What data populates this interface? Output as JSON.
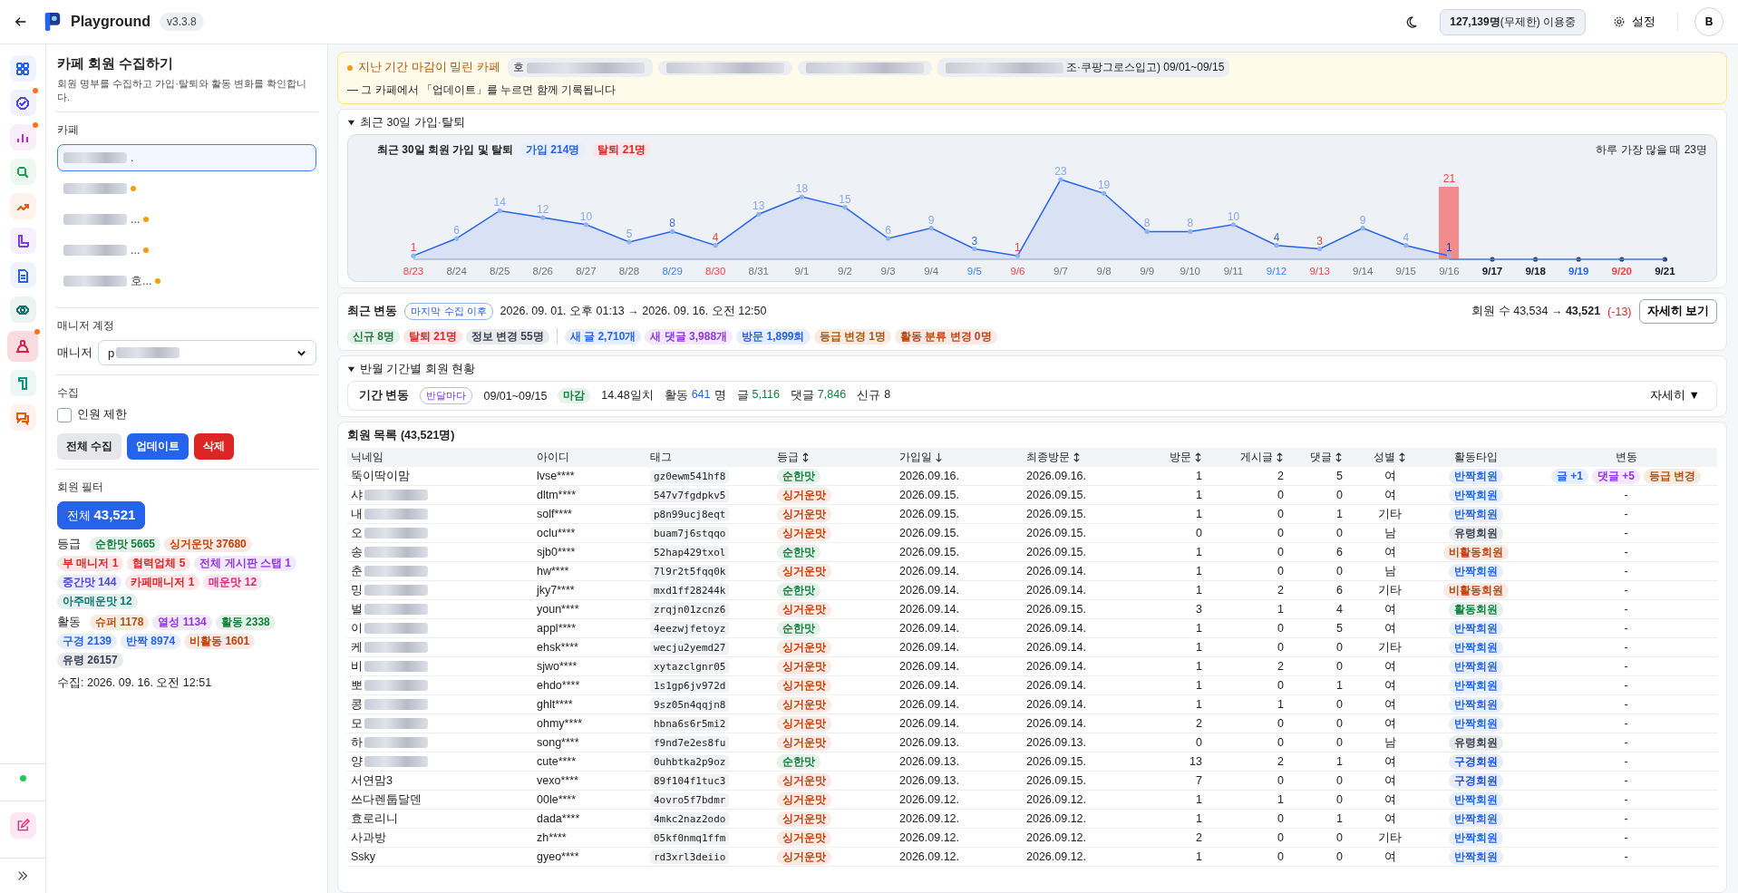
{
  "header": {
    "app_name": "Playground",
    "version": "v3.3.8",
    "usage": "**127,139명**(무제한) 이용중",
    "settings": "설정",
    "avatar": "B"
  },
  "rail": {
    "items": [
      {
        "color": "#2563eb",
        "selected": false,
        "badge": false
      },
      {
        "color": "#4f46e5",
        "selected": false,
        "badge": true
      },
      {
        "color": "#c026d3",
        "selected": false,
        "badge": true
      },
      {
        "color": "#16a34a",
        "selected": false,
        "badge": false
      },
      {
        "color": "#ea580c",
        "selected": false,
        "badge": false
      },
      {
        "color": "#7c3aed",
        "selected": false,
        "badge": false
      },
      {
        "color": "#2563eb",
        "selected": false,
        "badge": false
      },
      {
        "color": "#0f766e",
        "selected": false,
        "badge": false
      },
      {
        "color": "#e11d48",
        "selected": true,
        "badge": true
      },
      {
        "color": "#0d9488",
        "selected": false,
        "badge": false
      },
      {
        "color": "#ea580c",
        "selected": false,
        "badge": false
      }
    ],
    "online": true
  },
  "sidebar": {
    "title": "카페 회원 수집하기",
    "subtitle": "회원 명부를 수집하고 가입·탈퇴와 활동 변화를 확인합니다.",
    "cafe_label": "카페",
    "cafes": [
      {
        "text": ".",
        "blurred": true,
        "selected": true,
        "alert": false
      },
      {
        "blurred": true,
        "selected": false,
        "alert": true
      },
      {
        "text": "...",
        "blurred": true,
        "selected": false,
        "alert": true
      },
      {
        "text": "...",
        "blurred": true,
        "selected": false,
        "alert": true
      },
      {
        "text": "호...",
        "blurred": true,
        "selected": false,
        "alert": true
      }
    ],
    "manager_section": "매니저 계정",
    "manager_label": "매니저",
    "manager_value": {
      "text": "p",
      "blurred": true
    },
    "collect_section": "수집",
    "limit": {
      "label": "인원 제한",
      "checked": false
    },
    "buttons": [
      {
        "label": "전체 수집",
        "kind": "neutral"
      },
      {
        "label": "업데이트",
        "kind": "primary"
      },
      {
        "label": "삭제",
        "kind": "danger"
      }
    ],
    "filter_section": "회원 필터",
    "all_filter": {
      "label": "전체",
      "count": "43,521",
      "selected": true
    },
    "groups": [
      {
        "label": "등급",
        "chips": [
          {
            "text": "순한맛 5665",
            "color": "#15803d"
          },
          {
            "text": "싱거운맛 37680",
            "color": "#c2410c"
          },
          {
            "text": "부 매니저 1",
            "color": "#dc2626"
          },
          {
            "text": "협력업체 5",
            "color": "#dc2626"
          },
          {
            "text": "전체 게시판 스탭 1",
            "color": "#9333ea"
          },
          {
            "text": "중간맛 144",
            "color": "#4f46e5"
          },
          {
            "text": "카페매니저 1",
            "color": "#dc2626"
          },
          {
            "text": "매운맛 12",
            "color": "#db2777"
          },
          {
            "text": "아주매운맛 12",
            "color": "#0f766e"
          }
        ]
      },
      {
        "label": "활동",
        "chips": [
          {
            "text": "슈퍼 1178",
            "color": "#b45309"
          },
          {
            "text": "열성 1134",
            "color": "#9333ea"
          },
          {
            "text": "활동 2338",
            "color": "#15803d"
          },
          {
            "text": "구경 2139",
            "color": "#2563eb"
          },
          {
            "text": "반짝 8974",
            "color": "#2563eb"
          },
          {
            "text": "비활동 1601",
            "color": "#c2410c"
          },
          {
            "text": "유령 26157",
            "color": "#374151"
          }
        ]
      }
    ],
    "collected_at": "수집: 2026. 09. 16. 오전 12:51"
  },
  "banner": {
    "title": "지난 기간 마감이 밀린 카페",
    "cafes": [
      {
        "text": "호",
        "blur_after": true
      },
      {
        "blur_before": true
      },
      {
        "blur_before": true
      },
      {
        "text": "조·쿠팡그로스입고) 09/01~09/15",
        "blur_before": true
      }
    ],
    "note": "— 그 카페에서 「업데이트」를 누르면 함께 기록됩니다"
  },
  "recent": {
    "title": "최근 30일 가입·탈퇴",
    "expanded": true,
    "chart": {
      "title": "최근 30일 회원 가입 및 탈퇴",
      "joins": "214명",
      "leaves": "탈퇴 21명",
      "peak": "하루 가장 많을 때 23명",
      "days": [
        {
          "sat": false,
          "sun": true,
          "future": false
        },
        {
          "sat": false,
          "sun": false,
          "future": false
        },
        {
          "sat": false,
          "sun": false,
          "future": false
        },
        {
          "sat": false,
          "sun": false,
          "future": false
        },
        {
          "sat": false,
          "sun": false,
          "future": false
        },
        {
          "sat": false,
          "sun": false,
          "future": false
        },
        {
          "sat": true,
          "sun": false,
          "future": false
        },
        {
          "sat": false,
          "sun": true,
          "future": false
        },
        {
          "sat": false,
          "sun": false,
          "future": false
        },
        {
          "sat": false,
          "sun": false,
          "future": false
        },
        {
          "sat": false,
          "sun": false,
          "future": false
        },
        {
          "sat": false,
          "sun": false,
          "future": false
        },
        {
          "sat": false,
          "sun": false,
          "future": false
        },
        {
          "sat": true,
          "sun": false,
          "future": false
        },
        {
          "sat": false,
          "sun": true,
          "future": false
        },
        {
          "sat": false,
          "sun": false,
          "future": false
        },
        {
          "sat": false,
          "sun": false,
          "future": false
        },
        {
          "sat": false,
          "sun": false,
          "future": false
        },
        {
          "sat": false,
          "sun": false,
          "future": false
        },
        {
          "sat": false,
          "sun": false,
          "future": false
        },
        {
          "sat": true,
          "sun": false,
          "future": false
        },
        {
          "sat": false,
          "sun": true,
          "future": false
        },
        {
          "sat": false,
          "sun": false,
          "future": false
        },
        {
          "sat": false,
          "sun": false,
          "future": false
        },
        {
          "sat": false,
          "sun": false,
          "future": false,
          "leave": {
            "level": 0.913,
            "label": "21"
          }
        },
        {
          "sat": false,
          "sun": false,
          "future": true
        },
        {
          "sat": false,
          "sun": false,
          "future": true
        },
        {
          "sat": true,
          "sun": false,
          "future": true
        },
        {
          "sat": false,
          "sun": true,
          "future": true
        },
        {
          "sat": false,
          "sun": false,
          "future": true
        }
      ],
      "chart_data": {
        "type": "area",
        "data_labels": true,
        "categories": [
          "8/23",
          "8/24",
          "8/25",
          "8/26",
          "8/27",
          "8/28",
          "8/29",
          "8/30",
          "8/31",
          "9/1",
          "9/2",
          "9/3",
          "9/4",
          "9/5",
          "9/6",
          "9/7",
          "9/8",
          "9/9",
          "9/10",
          "9/11",
          "9/12",
          "9/13",
          "9/14",
          "9/15",
          "9/16",
          "9/17",
          "9/18",
          "9/19",
          "9/20",
          "9/21"
        ],
        "series": [
          {
            "name": "가입",
            "color": "#2563eb",
            "values": [
              1,
              6,
              14,
              12,
              10,
              5,
              8,
              4,
              13,
              18,
              15,
              6,
              9,
              3,
              1,
              23,
              19,
              8,
              8,
              10,
              4,
              3,
              9,
              4,
              1,
              null,
              null,
              null,
              null,
              null
            ]
          }
        ]
      }
    }
  },
  "changes": {
    "title": "최근 변동",
    "since": "마지막 수집 이후",
    "range": "2026. 09. 01. 오후 01:13 → 2026. 09. 16. 오전 12:50",
    "members": "회원 수 43,534 → **43,521**",
    "delta": "(-13)",
    "details": "자세히 보기",
    "chips": [
      {
        "text": "신규 8명",
        "color": "#15803d"
      },
      {
        "text": "탈퇴 21명",
        "color": "#dc2626"
      },
      {
        "text": "정보 변경 55명",
        "color": "#374151"
      },
      {
        "text": "새 글 2,710개",
        "color": "#2563eb"
      },
      {
        "text": "새 댓글 3,988개",
        "color": "#9333ea"
      },
      {
        "text": "방문 1,899회",
        "color": "#2563eb"
      },
      {
        "text": "등급 변경 1명",
        "color": "#b45309"
      },
      {
        "text": "활동 분류 변경 0명",
        "color": "#c2410c"
      }
    ]
  },
  "periods": {
    "title": "반월 기간별 회원 현황",
    "expanded": true,
    "label": "기간 변동",
    "cadence": "반달마다",
    "range": "09/01~09/15",
    "status": "마감",
    "coverage": "14.48일치",
    "stats": [
      {
        "label": "활동",
        "value": "641",
        "unit": "명",
        "color": "#2563eb"
      },
      {
        "label": "글",
        "value": "5,116",
        "color": "#15803d"
      },
      {
        "label": "댓글",
        "value": "7,846",
        "color": "#15803d"
      },
      {
        "label": "신규",
        "value": "8"
      }
    ],
    "more": "자세히 ▼"
  },
  "table": {
    "title": "회원 목록 (43,521명)",
    "columns": [
      {
        "label": "닉네임",
        "sortable": false
      },
      {
        "label": "아이디",
        "sortable": false
      },
      {
        "label": "태그",
        "sortable": false
      },
      {
        "label": "등급",
        "sortable": true,
        "sorted": false
      },
      {
        "label": "가입일",
        "sortable": true,
        "sorted": true
      },
      {
        "label": "최종방문",
        "sortable": true,
        "sorted": false
      },
      {
        "label": "방문",
        "sortable": true,
        "sorted": false
      },
      {
        "label": "게시글",
        "sortable": true,
        "sorted": false
      },
      {
        "label": "댓글",
        "sortable": true,
        "sorted": false
      },
      {
        "label": "성별",
        "sortable": true,
        "sorted": false
      },
      {
        "label": "활동타입",
        "sortable": false
      },
      {
        "label": "변동",
        "sortable": false
      }
    ],
    "rows": [
      {
        "name": "뚝이딱이맘",
        "blurred": false,
        "id": "lvse****",
        "tag": "gz0ewm541hf8",
        "grade": {
          "text": "순한맛",
          "color": "#15803d"
        },
        "joined": "2026.09.16.",
        "last": "2026.09.16.",
        "visits": "1",
        "posts": "2",
        "comments": "5",
        "gender": "여",
        "activity": {
          "text": "반짝회원",
          "color": "#2563eb"
        },
        "changes": [
          {
            "text": "글 +1",
            "color": "#2563eb"
          },
          {
            "text": "댓글 +5",
            "color": "#9333ea"
          },
          {
            "text": "등급 변경",
            "color": "#b45309"
          }
        ]
      },
      {
        "name": "샤",
        "blurred": true,
        "id": "dltm****",
        "tag": "547v7fgdpkv5",
        "grade": {
          "text": "싱거운맛",
          "color": "#c2410c"
        },
        "joined": "2026.09.15.",
        "last": "2026.09.15.",
        "visits": "1",
        "posts": "0",
        "comments": "0",
        "gender": "여",
        "activity": {
          "text": "반짝회원",
          "color": "#2563eb"
        },
        "change": "-"
      },
      {
        "name": "내",
        "blurred": true,
        "id": "solf****",
        "tag": "p8n99ucj8eqt",
        "grade": {
          "text": "싱거운맛",
          "color": "#c2410c"
        },
        "joined": "2026.09.15.",
        "last": "2026.09.15.",
        "visits": "1",
        "posts": "0",
        "comments": "1",
        "gender": "기타",
        "activity": {
          "text": "반짝회원",
          "color": "#2563eb"
        },
        "change": "-"
      },
      {
        "name": "오",
        "blurred": true,
        "id": "oclu****",
        "tag": "buam7j6stqqo",
        "grade": {
          "text": "싱거운맛",
          "color": "#c2410c"
        },
        "joined": "2026.09.15.",
        "last": "2026.09.15.",
        "visits": "0",
        "posts": "0",
        "comments": "0",
        "gender": "남",
        "activity": {
          "text": "유령회원",
          "color": "#374151"
        },
        "change": "-"
      },
      {
        "name": "송",
        "blurred": true,
        "id": "sjb0****",
        "tag": "52hap429txol",
        "grade": {
          "text": "순한맛",
          "color": "#15803d"
        },
        "joined": "2026.09.15.",
        "last": "2026.09.15.",
        "visits": "1",
        "posts": "0",
        "comments": "6",
        "gender": "여",
        "activity": {
          "text": "비활동회원",
          "color": "#c2410c"
        },
        "change": "-"
      },
      {
        "name": "춘",
        "blurred": true,
        "id": "hw****",
        "tag": "7l9r2t5fqq0k",
        "grade": {
          "text": "싱거운맛",
          "color": "#c2410c"
        },
        "joined": "2026.09.14.",
        "last": "2026.09.14.",
        "visits": "1",
        "posts": "0",
        "comments": "0",
        "gender": "남",
        "activity": {
          "text": "반짝회원",
          "color": "#2563eb"
        },
        "change": "-"
      },
      {
        "name": "밍",
        "blurred": true,
        "id": "jky7****",
        "tag": "mxd1ff28244k",
        "grade": {
          "text": "순한맛",
          "color": "#15803d"
        },
        "joined": "2026.09.14.",
        "last": "2026.09.14.",
        "visits": "1",
        "posts": "2",
        "comments": "6",
        "gender": "기타",
        "activity": {
          "text": "비활동회원",
          "color": "#c2410c"
        },
        "change": "-"
      },
      {
        "name": "벌",
        "blurred": true,
        "id": "youn****",
        "tag": "zrqjn01zcnz6",
        "grade": {
          "text": "싱거운맛",
          "color": "#c2410c"
        },
        "joined": "2026.09.14.",
        "last": "2026.09.15.",
        "visits": "3",
        "posts": "1",
        "comments": "4",
        "gender": "여",
        "activity": {
          "text": "활동회원",
          "color": "#15803d"
        },
        "change": "-"
      },
      {
        "name": "이",
        "blurred": true,
        "id": "appl****",
        "tag": "4eezwjfetoyz",
        "grade": {
          "text": "순한맛",
          "color": "#15803d"
        },
        "joined": "2026.09.14.",
        "last": "2026.09.14.",
        "visits": "1",
        "posts": "0",
        "comments": "5",
        "gender": "여",
        "activity": {
          "text": "반짝회원",
          "color": "#2563eb"
        },
        "change": "-"
      },
      {
        "name": "케",
        "blurred": true,
        "id": "ehsk****",
        "tag": "wecju2yemd27",
        "grade": {
          "text": "싱거운맛",
          "color": "#c2410c"
        },
        "joined": "2026.09.14.",
        "last": "2026.09.14.",
        "visits": "1",
        "posts": "0",
        "comments": "0",
        "gender": "기타",
        "activity": {
          "text": "반짝회원",
          "color": "#2563eb"
        },
        "change": "-"
      },
      {
        "name": "비",
        "blurred": true,
        "id": "sjwo****",
        "tag": "xytazclgnr05",
        "grade": {
          "text": "싱거운맛",
          "color": "#c2410c"
        },
        "joined": "2026.09.14.",
        "last": "2026.09.14.",
        "visits": "1",
        "posts": "2",
        "comments": "0",
        "gender": "여",
        "activity": {
          "text": "반짝회원",
          "color": "#2563eb"
        },
        "change": "-"
      },
      {
        "name": "뽀",
        "blurred": true,
        "id": "ehdo****",
        "tag": "1s1gp6jv972d",
        "grade": {
          "text": "싱거운맛",
          "color": "#c2410c"
        },
        "joined": "2026.09.14.",
        "last": "2026.09.14.",
        "visits": "1",
        "posts": "0",
        "comments": "1",
        "gender": "여",
        "activity": {
          "text": "반짝회원",
          "color": "#2563eb"
        },
        "change": "-"
      },
      {
        "name": "콩",
        "blurred": true,
        "id": "ghlt****",
        "tag": "9sz05n4qqjn8",
        "grade": {
          "text": "싱거운맛",
          "color": "#c2410c"
        },
        "joined": "2026.09.14.",
        "last": "2026.09.14.",
        "visits": "1",
        "posts": "1",
        "comments": "0",
        "gender": "여",
        "activity": {
          "text": "반짝회원",
          "color": "#2563eb"
        },
        "change": "-"
      },
      {
        "name": "모",
        "blurred": true,
        "id": "ohmy****",
        "tag": "hbna6s6r5mi2",
        "grade": {
          "text": "싱거운맛",
          "color": "#c2410c"
        },
        "joined": "2026.09.14.",
        "last": "2026.09.14.",
        "visits": "2",
        "posts": "0",
        "comments": "0",
        "gender": "여",
        "activity": {
          "text": "반짝회원",
          "color": "#2563eb"
        },
        "change": "-"
      },
      {
        "name": "하",
        "blurred": true,
        "id": "song****",
        "tag": "f9nd7e2es8fu",
        "grade": {
          "text": "싱거운맛",
          "color": "#c2410c"
        },
        "joined": "2026.09.13.",
        "last": "2026.09.13.",
        "visits": "0",
        "posts": "0",
        "comments": "0",
        "gender": "남",
        "activity": {
          "text": "유령회원",
          "color": "#374151"
        },
        "change": "-"
      },
      {
        "name": "양",
        "blurred": true,
        "id": "cute****",
        "tag": "0uhbtka2p9oz",
        "grade": {
          "text": "순한맛",
          "color": "#15803d"
        },
        "joined": "2026.09.13.",
        "last": "2026.09.15.",
        "visits": "13",
        "posts": "2",
        "comments": "1",
        "gender": "여",
        "activity": {
          "text": "구경회원",
          "color": "#1d4ed8"
        },
        "change": "-"
      },
      {
        "name": "서연맘3",
        "blurred": false,
        "id": "vexo****",
        "tag": "89f104f1tuc3",
        "grade": {
          "text": "싱거운맛",
          "color": "#c2410c"
        },
        "joined": "2026.09.13.",
        "last": "2026.09.15.",
        "visits": "7",
        "posts": "0",
        "comments": "0",
        "gender": "여",
        "activity": {
          "text": "구경회원",
          "color": "#1d4ed8"
        },
        "change": "-"
      },
      {
        "name": "쓰다렌툽달덴",
        "blurred": false,
        "id": "00le****",
        "tag": "4ovro5f7bdmr",
        "grade": {
          "text": "싱거운맛",
          "color": "#c2410c"
        },
        "joined": "2026.09.12.",
        "last": "2026.09.12.",
        "visits": "1",
        "posts": "1",
        "comments": "0",
        "gender": "여",
        "activity": {
          "text": "반짝회원",
          "color": "#2563eb"
        },
        "change": "-"
      },
      {
        "name": "효로리니",
        "blurred": false,
        "id": "dada****",
        "tag": "4mkc2naz2odo",
        "grade": {
          "text": "싱거운맛",
          "color": "#c2410c"
        },
        "joined": "2026.09.12.",
        "last": "2026.09.12.",
        "visits": "1",
        "posts": "0",
        "comments": "1",
        "gender": "여",
        "activity": {
          "text": "반짝회원",
          "color": "#2563eb"
        },
        "change": "-"
      },
      {
        "name": "사과방",
        "blurred": false,
        "id": "zh****",
        "tag": "05kf0nmq1ffm",
        "grade": {
          "text": "싱거운맛",
          "color": "#c2410c"
        },
        "joined": "2026.09.12.",
        "last": "2026.09.12.",
        "visits": "2",
        "posts": "0",
        "comments": "0",
        "gender": "기타",
        "activity": {
          "text": "반짝회원",
          "color": "#2563eb"
        },
        "change": "-"
      },
      {
        "name": "Ssky",
        "blurred": false,
        "id": "gyeo****",
        "tag": "rd3xrl3deiio",
        "grade": {
          "text": "싱거운맛",
          "color": "#c2410c"
        },
        "joined": "2026.09.12.",
        "last": "2026.09.12.",
        "visits": "1",
        "posts": "0",
        "comments": "0",
        "gender": "여",
        "activity": {
          "text": "반짝회원",
          "color": "#2563eb"
        },
        "change": "-"
      }
    ]
  }
}
